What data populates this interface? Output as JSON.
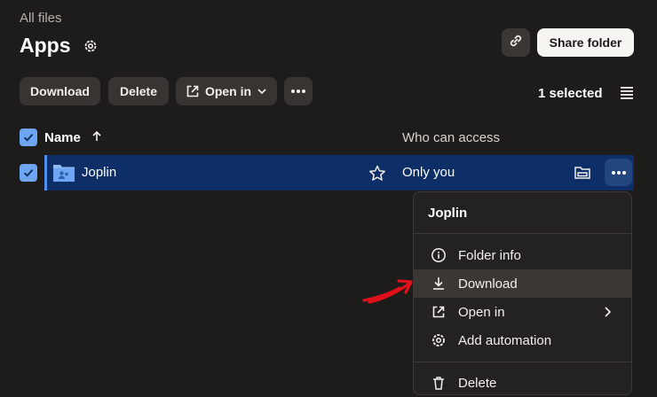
{
  "breadcrumb": "All files",
  "page_title": "Apps",
  "header": {
    "share_folder_label": "Share folder"
  },
  "toolbar": {
    "download_label": "Download",
    "delete_label": "Delete",
    "open_in_label": "Open in",
    "selected_text": "1 selected"
  },
  "table": {
    "columns": {
      "name": "Name",
      "access": "Who can access"
    },
    "rows": [
      {
        "name": "Joplin",
        "access": "Only you",
        "checked": true
      }
    ]
  },
  "context_menu": {
    "title": "Joplin",
    "items": [
      {
        "label": "Folder info",
        "icon": "info-icon"
      },
      {
        "label": "Download",
        "icon": "download-icon",
        "highlighted": true
      },
      {
        "label": "Open in",
        "icon": "open-external-icon",
        "has_submenu": true
      },
      {
        "label": "Add automation",
        "icon": "automation-gear-icon"
      },
      {
        "label": "Delete",
        "icon": "trash-icon"
      }
    ]
  },
  "colors": {
    "background": "#1e1c1b",
    "accent": "#6ea6f5",
    "selected_row": "#0d2e66",
    "annotation_arrow": "#e0101a"
  }
}
